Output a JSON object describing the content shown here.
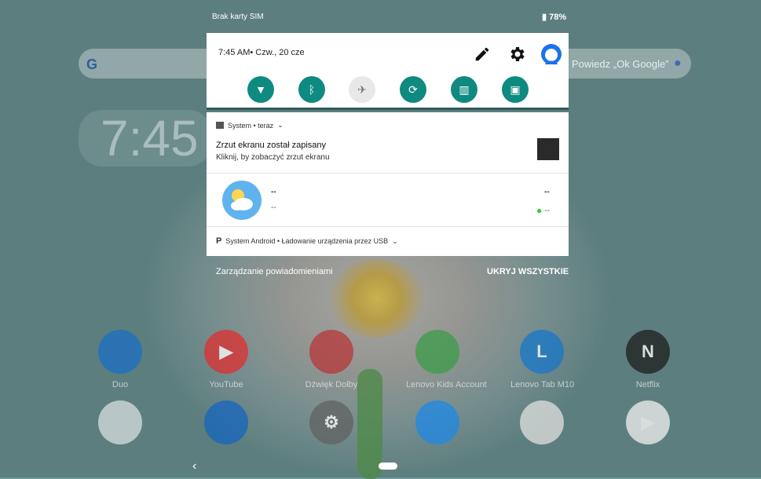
{
  "status_bar": {
    "carrier": "Brak karty SIM",
    "battery": "78%"
  },
  "home": {
    "search_hint": "Powiedz „Ok Google”",
    "google_letter": "G",
    "clock": "7:45",
    "apps_row1": [
      {
        "label": "Duo",
        "color": "#1a6fc4",
        "glyph": ""
      },
      {
        "label": "YouTube",
        "color": "#e02f2f",
        "glyph": "▶"
      },
      {
        "label": "Dźwięk Dolby",
        "color": "#b7373a",
        "glyph": ""
      },
      {
        "label": "Lenovo Kids Account",
        "color": "#3b9c4a",
        "glyph": ""
      },
      {
        "label": "Lenovo Tab M10",
        "color": "#1777c9",
        "glyph": "L"
      },
      {
        "label": "Netflix",
        "color": "#1d1d1d",
        "glyph": "N"
      }
    ],
    "apps_row2": [
      {
        "label": "",
        "color": "#d8dfe0",
        "glyph": ""
      },
      {
        "label": "",
        "color": "#1565c0",
        "glyph": ""
      },
      {
        "label": "",
        "color": "#616161",
        "glyph": "⚙"
      },
      {
        "label": "",
        "color": "#1e88e5",
        "glyph": ""
      },
      {
        "label": "",
        "color": "#e0e0e0",
        "glyph": ""
      },
      {
        "label": "",
        "color": "#f1f1f1",
        "glyph": "▶"
      }
    ]
  },
  "quick_settings": {
    "datetime": "7:45 AM• Czw., 20 cze",
    "top_icons": [
      "edit-icon",
      "settings-icon",
      "account-icon"
    ],
    "tiles": [
      {
        "name": "wifi-tile",
        "icon": "wifi-off-icon",
        "glyph": "▼",
        "on": true
      },
      {
        "name": "bluetooth-tile",
        "icon": "bluetooth-icon",
        "glyph": "ᛒ",
        "on": true
      },
      {
        "name": "airplane-tile",
        "icon": "airplane-icon",
        "glyph": "✈",
        "on": false
      },
      {
        "name": "autorotate-tile",
        "icon": "rotate-icon",
        "glyph": "⟳",
        "on": true
      },
      {
        "name": "reading-mode-tile",
        "icon": "book-icon",
        "glyph": "▥",
        "on": true
      },
      {
        "name": "cast-tile",
        "icon": "screen-cast-icon",
        "glyph": "▣",
        "on": true
      }
    ],
    "accent": "#0f8a80"
  },
  "notifications": {
    "screenshot": {
      "app": "System • teraz",
      "title": "Zrzut ekranu został zapisany",
      "text": "Kliknij, by zobaczyć zrzut ekranu"
    },
    "weather": {
      "line1": "--",
      "line2": "--",
      "right1": "--",
      "right2": "--"
    },
    "usb": {
      "app": "System Android • Ładowanie urządzenia przez USB"
    }
  },
  "footer": {
    "manage": "Zarządzanie powiadomieniami",
    "hide_all": "UKRYJ WSZYSTKIE"
  }
}
